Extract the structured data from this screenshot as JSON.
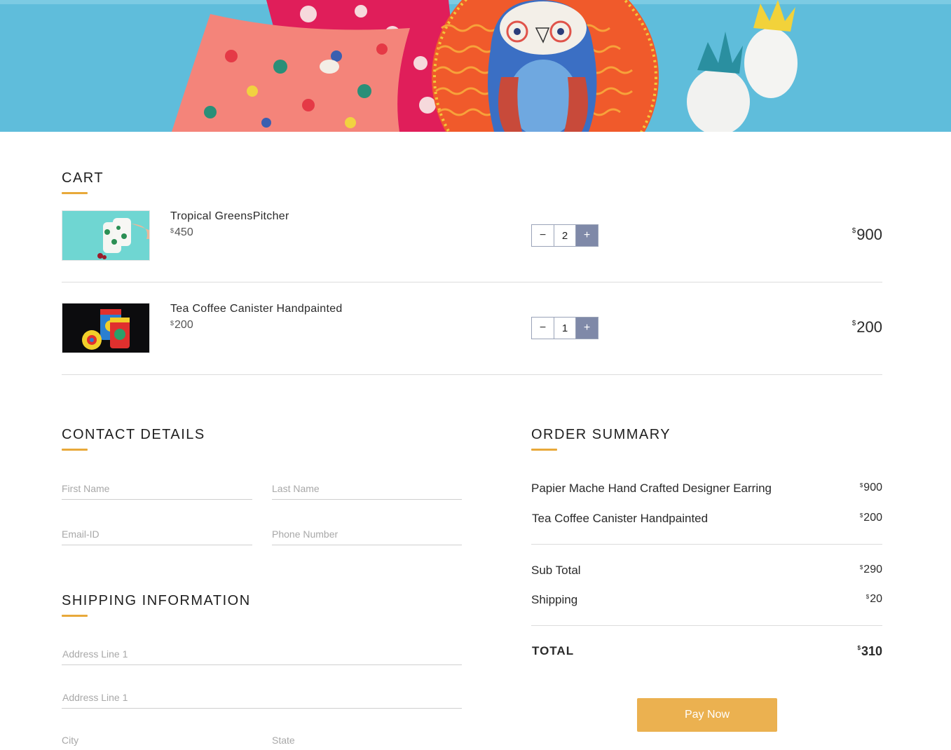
{
  "sections": {
    "cart": "CART",
    "contact": "CONTACT DETAILS",
    "shipping": "SHIPPING INFORMATION",
    "summary": "ORDER SUMMARY"
  },
  "cart": {
    "items": [
      {
        "name": "Tropical GreensPitcher",
        "currency": "$",
        "unit_price": "450",
        "quantity": "2",
        "line_total": "900"
      },
      {
        "name": "Tea Coffee Canister Handpainted",
        "currency": "$",
        "unit_price": "200",
        "quantity": "1",
        "line_total": "200"
      }
    ],
    "minus_symbol": "−",
    "plus_symbol": "+"
  },
  "contact": {
    "first_name": {
      "placeholder": "First Name",
      "value": ""
    },
    "last_name": {
      "placeholder": "Last Name",
      "value": ""
    },
    "email": {
      "placeholder": "Email-ID",
      "value": ""
    },
    "phone": {
      "placeholder": "Phone Number",
      "value": ""
    }
  },
  "shipping": {
    "address1": {
      "placeholder": "Address Line 1",
      "value": ""
    },
    "address2": {
      "placeholder": "Address Line 1",
      "value": ""
    },
    "city": {
      "placeholder": "City",
      "value": ""
    },
    "state": {
      "placeholder": "State",
      "value": ""
    }
  },
  "summary": {
    "items": [
      {
        "name": "Papier Mache Hand Crafted Designer Earring",
        "currency": "$",
        "price": "900"
      },
      {
        "name": "Tea Coffee Canister Handpainted",
        "currency": "$",
        "price": "200"
      }
    ],
    "subtotal_label": "Sub Total",
    "subtotal_currency": "$",
    "subtotal": "290",
    "shipping_label": "Shipping",
    "shipping_currency": "$",
    "shipping": "20",
    "total_label": "TOTAL",
    "total_currency": "$",
    "total": "310"
  },
  "pay_button": "Pay Now",
  "colors": {
    "accent": "#e8a93a",
    "pay_button": "#ebb150",
    "stepper_plus": "#7f89a8",
    "hero_background": "#5fbddb"
  }
}
